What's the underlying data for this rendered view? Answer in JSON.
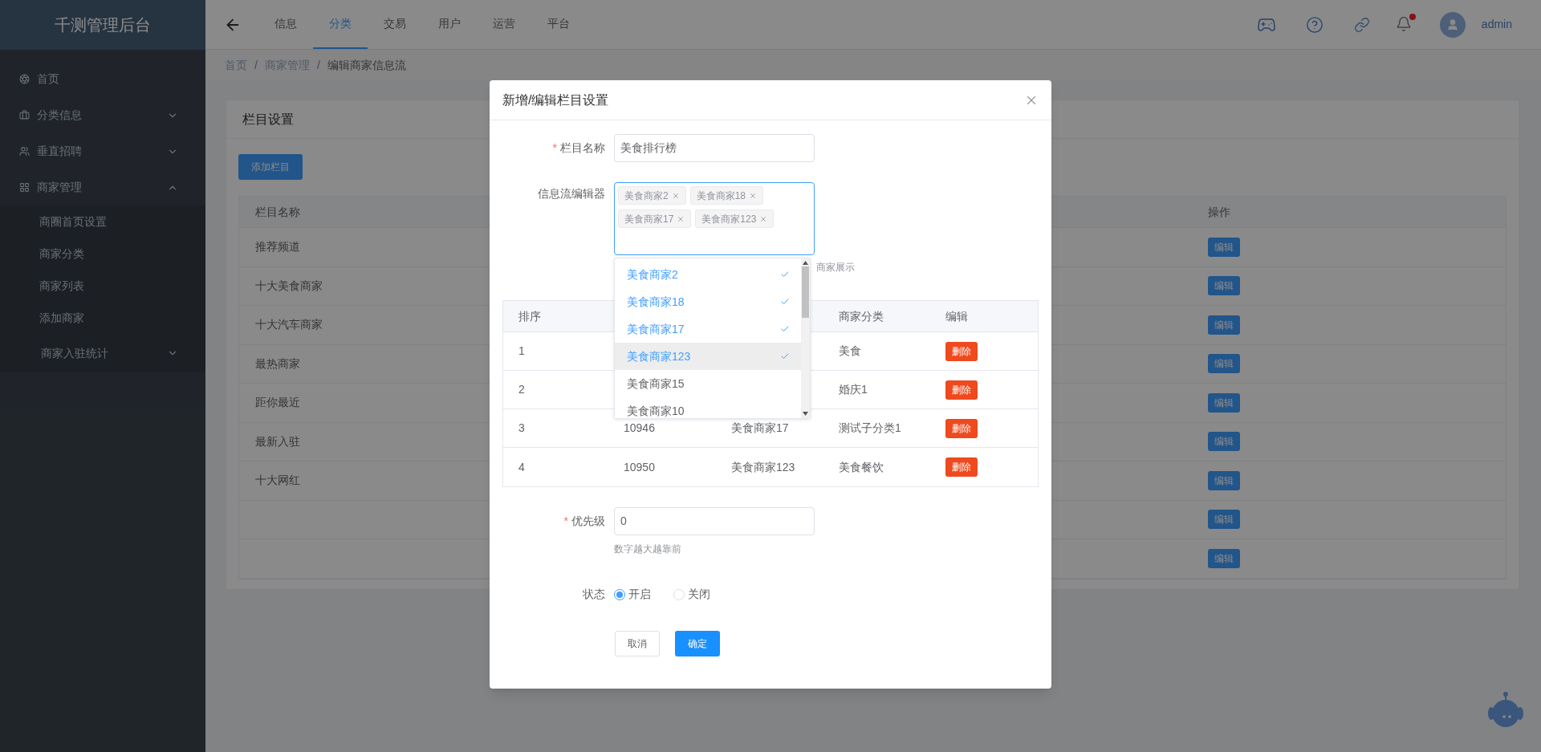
{
  "sidebar": {
    "logo": "千测管理后台",
    "items": [
      {
        "label": "首页",
        "kind": "link"
      },
      {
        "label": "分类信息",
        "kind": "submenu",
        "expanded": false
      },
      {
        "label": "垂直招聘",
        "kind": "submenu",
        "expanded": false
      },
      {
        "label": "商家管理",
        "kind": "submenu",
        "expanded": true,
        "children": [
          {
            "label": "商圈首页设置",
            "kind": "link"
          },
          {
            "label": "商家分类",
            "kind": "link"
          },
          {
            "label": "商家列表",
            "kind": "link"
          },
          {
            "label": "添加商家",
            "kind": "link"
          },
          {
            "label": "商家入驻统计",
            "kind": "submenu",
            "expanded": false
          }
        ]
      }
    ]
  },
  "header": {
    "tabs": [
      {
        "label": "信息",
        "selected": false
      },
      {
        "label": "分类",
        "selected": true
      },
      {
        "label": "交易",
        "selected": false
      },
      {
        "label": "用户",
        "selected": false
      },
      {
        "label": "运营",
        "selected": false
      },
      {
        "label": "平台",
        "selected": false
      }
    ],
    "notification_dot": true,
    "user": "admin"
  },
  "breadcrumb": {
    "separator": "/",
    "items": [
      "首页",
      "商家管理",
      "编辑商家信息流"
    ]
  },
  "card": {
    "title": "栏目设置",
    "add_button": "添加栏目",
    "table": {
      "columns": [
        "栏目名称",
        "操作"
      ],
      "rows": [
        {
          "name": "推荐频道",
          "action": "编辑"
        },
        {
          "name": "十大美食商家",
          "action": "编辑"
        },
        {
          "name": "十大汽车商家",
          "action": "编辑"
        },
        {
          "name": "最热商家",
          "action": "编辑"
        },
        {
          "name": "距你最近",
          "action": "编辑"
        },
        {
          "name": "最新入驻",
          "action": "编辑"
        },
        {
          "name": "十大网红",
          "action": "编辑"
        },
        {
          "action": "编辑"
        },
        {
          "action": "编辑"
        }
      ]
    }
  },
  "dialog": {
    "title": "新增/编辑栏目设置",
    "name_field": {
      "required_mark": "*",
      "label": "栏目名称",
      "value": "美食排行榜"
    },
    "feed_editor": {
      "label": "信息流编辑器",
      "focused": true,
      "tags": [
        "美食商家2",
        "美食商家18",
        "美食商家17",
        "美食商家123"
      ],
      "hint": "商家展示",
      "options": [
        {
          "label": "美食商家2",
          "selected": true,
          "hovered": false
        },
        {
          "label": "美食商家18",
          "selected": true,
          "hovered": false
        },
        {
          "label": "美食商家17",
          "selected": true,
          "hovered": false
        },
        {
          "label": "美食商家123",
          "selected": true,
          "hovered": true
        },
        {
          "label": "美食商家15",
          "selected": false,
          "hovered": false
        },
        {
          "label": "美食商家10",
          "selected": false,
          "hovered": false
        }
      ]
    },
    "table": {
      "columns": {
        "sort": "排序",
        "category": "商家分类",
        "action": "编辑"
      },
      "rows": [
        {
          "sort": "1",
          "category": "美食",
          "action": "删除"
        },
        {
          "sort": "2",
          "category": "婚庆1",
          "action": "删除"
        },
        {
          "sort": "3",
          "column_2": "10946",
          "column_3": "美食商家17",
          "category": "测试子分类1",
          "action": "删除"
        },
        {
          "sort": "4",
          "column_2": "10950",
          "column_3": "美食商家123",
          "category": "美食餐饮",
          "action": "删除"
        }
      ]
    },
    "priority_field": {
      "required_mark": "*",
      "label": "优先级",
      "value": "0",
      "hint": "数字越大越靠前"
    },
    "status": {
      "label": "状态",
      "options": [
        {
          "label": "开启",
          "selected": true
        },
        {
          "label": "关闭",
          "selected": false
        }
      ]
    },
    "buttons": [
      {
        "label": "取消",
        "kind": "default"
      },
      {
        "label": "确定",
        "kind": "primary"
      }
    ]
  }
}
